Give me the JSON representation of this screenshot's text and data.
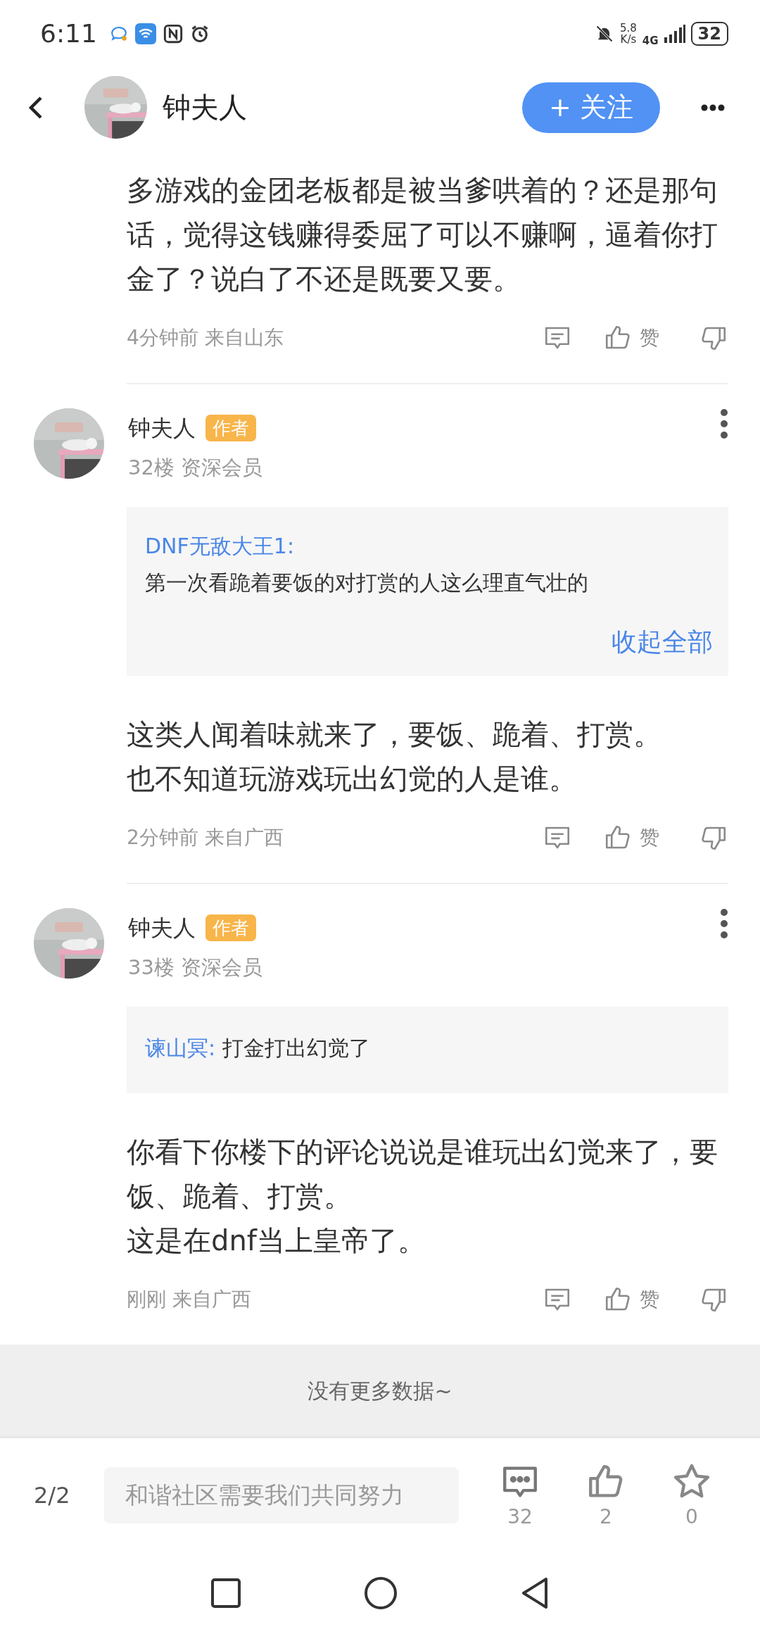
{
  "status_bar": {
    "time": "6:11",
    "net_speed": "5.8",
    "net_speed_unit": "K/s",
    "network": "4G",
    "battery": "32"
  },
  "header": {
    "title": "钟夫人",
    "follow_button": "+ 关注"
  },
  "comments": [
    {
      "kind": "partial",
      "body": [
        "多游戏的金团老板都是被当爹哄着的？还是那句话，觉得这钱赚得委屈了可以不赚啊，逼着你打金了？说白了不还是既要又要。"
      ],
      "meta": "4分钟前 来自山东",
      "like_label": "赞"
    },
    {
      "kind": "full",
      "author": "钟夫人",
      "badge": "作者",
      "floor": "32楼 资深会员",
      "quote": {
        "kind": "stacked",
        "author": "DNF无敌大王1:",
        "text": "第一次看跪着要饭的对打赏的人这么理直气壮的",
        "collapse": "收起全部"
      },
      "body": [
        "这类人闻着味就来了，要饭、跪着、打赏。",
        "也不知道玩游戏玩出幻觉的人是谁。"
      ],
      "meta": "2分钟前 来自广西",
      "like_label": "赞"
    },
    {
      "kind": "full",
      "author": "钟夫人",
      "badge": "作者",
      "floor": "33楼 资深会员",
      "quote": {
        "kind": "inline",
        "author": "谏山冥:",
        "text": "打金打出幻觉了"
      },
      "body": [
        "你看下你楼下的评论说说是谁玩出幻觉来了，要饭、跪着、打赏。",
        "这是在dnf当上皇帝了。"
      ],
      "meta": "刚刚 来自广西",
      "like_label": "赞"
    }
  ],
  "end_notice": "没有更多数据~",
  "reply_bar": {
    "page": "2/2",
    "placeholder": "和谐社区需要我们共同努力",
    "comment_count": "32",
    "like_count": "2",
    "favorite_count": "0"
  }
}
